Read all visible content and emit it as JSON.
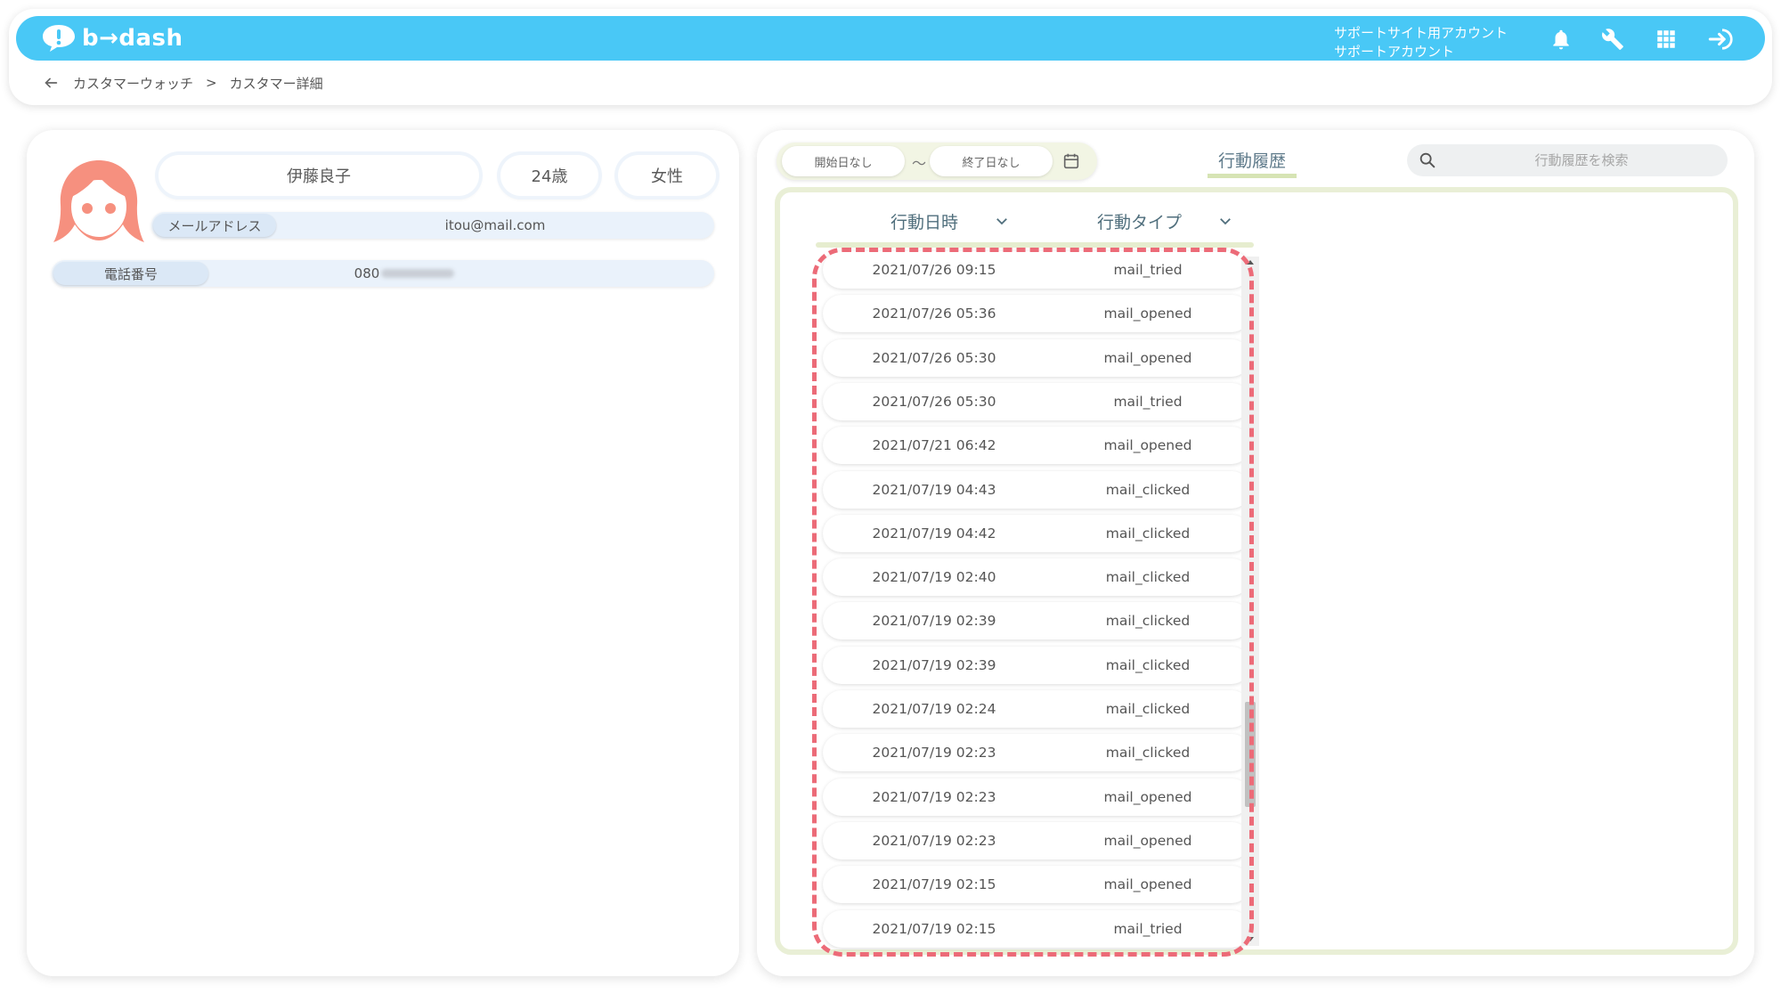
{
  "header": {
    "logo_text": "b→dash",
    "account_line1": "サポートサイト用アカウント",
    "account_line2": "サポートアカウント",
    "icons": [
      "bell-icon",
      "wrench-icon",
      "apps-grid-icon",
      "logout-icon"
    ],
    "bar_color": "#49c8f6"
  },
  "breadcrumb": {
    "parent": "カスタマーウォッチ",
    "separator": ">",
    "current": "カスタマー詳細"
  },
  "customer": {
    "name": "伊藤良子",
    "age": "24歳",
    "gender": "女性",
    "email_label": "メールアドレス",
    "email": "itou@mail.com",
    "phone_label": "電話番号",
    "phone_visible": "080"
  },
  "history": {
    "title": "行動履歴",
    "start_date_placeholder": "開始日なし",
    "range_separator": "～",
    "end_date_placeholder": "終了日なし",
    "search_placeholder": "行動履歴を検索",
    "col_datetime": "行動日時",
    "col_type": "行動タイプ",
    "rows": [
      {
        "datetime": "2021/07/26 09:15",
        "type": "mail_tried"
      },
      {
        "datetime": "2021/07/26 05:36",
        "type": "mail_opened"
      },
      {
        "datetime": "2021/07/26 05:30",
        "type": "mail_opened"
      },
      {
        "datetime": "2021/07/26 05:30",
        "type": "mail_tried"
      },
      {
        "datetime": "2021/07/21 06:42",
        "type": "mail_opened"
      },
      {
        "datetime": "2021/07/19 04:43",
        "type": "mail_clicked"
      },
      {
        "datetime": "2021/07/19 04:42",
        "type": "mail_clicked"
      },
      {
        "datetime": "2021/07/19 02:40",
        "type": "mail_clicked"
      },
      {
        "datetime": "2021/07/19 02:39",
        "type": "mail_clicked"
      },
      {
        "datetime": "2021/07/19 02:39",
        "type": "mail_clicked"
      },
      {
        "datetime": "2021/07/19 02:24",
        "type": "mail_clicked"
      },
      {
        "datetime": "2021/07/19 02:23",
        "type": "mail_clicked"
      },
      {
        "datetime": "2021/07/19 02:23",
        "type": "mail_opened"
      },
      {
        "datetime": "2021/07/19 02:23",
        "type": "mail_opened"
      },
      {
        "datetime": "2021/07/19 02:15",
        "type": "mail_opened"
      },
      {
        "datetime": "2021/07/19 02:15",
        "type": "mail_tried"
      }
    ],
    "highlight_color": "#ec6b78"
  }
}
